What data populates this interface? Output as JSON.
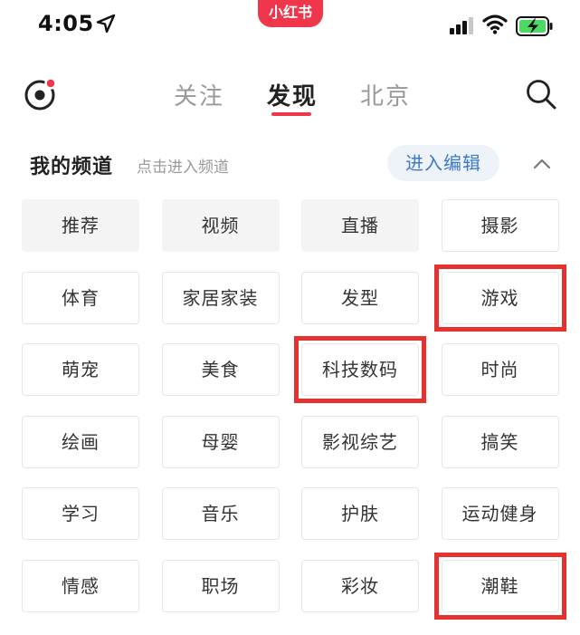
{
  "status_bar": {
    "time": "4:05",
    "app_badge": "小红书"
  },
  "nav": {
    "tabs": [
      {
        "label": "关注",
        "active": false
      },
      {
        "label": "发现",
        "active": true
      },
      {
        "label": "北京",
        "active": false
      }
    ]
  },
  "channels": {
    "title": "我的频道",
    "hint": "点击进入频道",
    "edit_label": "进入编辑",
    "items": [
      {
        "label": "推荐",
        "fixed": true
      },
      {
        "label": "视频",
        "fixed": true
      },
      {
        "label": "直播",
        "fixed": true
      },
      {
        "label": "摄影",
        "fixed": false
      },
      {
        "label": "体育",
        "fixed": false
      },
      {
        "label": "家居家装",
        "fixed": false
      },
      {
        "label": "发型",
        "fixed": false
      },
      {
        "label": "游戏",
        "fixed": false
      },
      {
        "label": "萌宠",
        "fixed": false
      },
      {
        "label": "美食",
        "fixed": false
      },
      {
        "label": "科技数码",
        "fixed": false
      },
      {
        "label": "时尚",
        "fixed": false
      },
      {
        "label": "绘画",
        "fixed": false
      },
      {
        "label": "母婴",
        "fixed": false
      },
      {
        "label": "影视综艺",
        "fixed": false
      },
      {
        "label": "搞笑",
        "fixed": false
      },
      {
        "label": "学习",
        "fixed": false
      },
      {
        "label": "音乐",
        "fixed": false
      },
      {
        "label": "护肤",
        "fixed": false
      },
      {
        "label": "运动健身",
        "fixed": false
      },
      {
        "label": "情感",
        "fixed": false
      },
      {
        "label": "职场",
        "fixed": false
      },
      {
        "label": "彩妆",
        "fixed": false
      },
      {
        "label": "潮鞋",
        "fixed": false
      }
    ],
    "highlighted": [
      "游戏",
      "科技数码",
      "潮鞋"
    ]
  },
  "colors": {
    "brand_red": "#f0364a",
    "highlight_red": "#e5322e",
    "edit_blue": "#3f79c8",
    "battery_green": "#4cd964"
  },
  "icons": {
    "explore": "explore-orbit-icon",
    "search": "search-icon",
    "collapse": "chevron-up-icon",
    "location": "location-arrow-icon",
    "signal": "cellular-signal-icon",
    "wifi": "wifi-icon",
    "battery": "battery-charging-icon"
  }
}
